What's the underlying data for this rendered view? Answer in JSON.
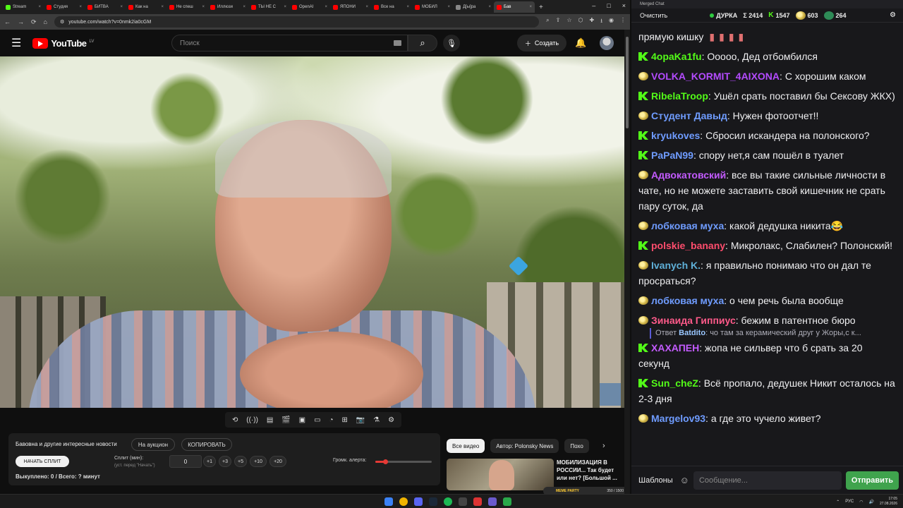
{
  "browser": {
    "tabs": [
      {
        "label": "Stream",
        "color": "#53fc18",
        "active": false
      },
      {
        "label": "Студия",
        "color": "#ff0000",
        "active": false
      },
      {
        "label": "БИТВА",
        "color": "#ff0000",
        "active": false
      },
      {
        "label": "Как на",
        "color": "#ff0000",
        "active": false
      },
      {
        "label": "Не спеш",
        "color": "#ff0000",
        "active": false
      },
      {
        "label": "Иллюзи",
        "color": "#ff0000",
        "active": false
      },
      {
        "label": "ТЫ НЕ С",
        "color": "#ff0000",
        "active": false
      },
      {
        "label": "OpenAI",
        "color": "#ff0000",
        "active": false
      },
      {
        "label": "ЯПОНИ",
        "color": "#ff0000",
        "active": false
      },
      {
        "label": "Все на",
        "color": "#ff0000",
        "active": false
      },
      {
        "label": "МОБИЛ",
        "color": "#ff0000",
        "active": false
      },
      {
        "label": "Д[ы]ра",
        "color": "#888888",
        "active": false
      },
      {
        "label": "Бав",
        "color": "#ff0000",
        "active": true
      }
    ],
    "url": "youtube.com/watch?v=0nmk2ia0cGM"
  },
  "youtube": {
    "logo_text": "YouTube",
    "region": "LV",
    "search_placeholder": "Поиск",
    "create_label": "Создать",
    "related_chips": [
      "Все видео",
      "Автор: Polonsky News",
      "Похо"
    ],
    "related_video_title": "МОБИЛИЗАЦИЯ В РОССИИ... Так будет или нет? [Большой ...",
    "thumb_tag": "МЕМЕ PARTY"
  },
  "panel": {
    "title": "Бавовна и другие интересные новости",
    "auction_label": "На аукцион",
    "copy_label": "КОПИРОВАТЬ",
    "start_split_label": "НАЧАТЬ СПЛИТ",
    "split_label": "Сплит (мин):",
    "split_sub": "(уст. перед \"Начать\")",
    "split_value": "0",
    "increments": [
      "+1",
      "+3",
      "+5",
      "+10",
      "+20"
    ],
    "volume_label": "Громк. алерта:",
    "volume_level": 0.17,
    "bought": "Выкуплено: 0 / Всего: ? минут",
    "counter": "350 / 1500"
  },
  "chat": {
    "window_title": "Merged Chat",
    "clear_label": "Очистить",
    "channel": "ДУРКА",
    "total": "Σ 2414",
    "kick_count": "1547",
    "twitch_count": "603",
    "other_count": "264",
    "messages": [
      {
        "badge": "none",
        "user": "",
        "color": "#efeff1",
        "text": "прямую кишку"
      },
      {
        "badge": "k",
        "user": "4opaKa1fu",
        "color": "#53fc18",
        "text": "Ооооо, Дед отбомбился"
      },
      {
        "badge": "t",
        "user": "VOLKA_KORMIT_4AIXONA",
        "color": "#b44bff",
        "text": "С хорошим каком"
      },
      {
        "badge": "k",
        "user": "RibelaTroop",
        "color": "#53fc18",
        "text": "Ушёл срать поставил бы Сексову ЖКХ)"
      },
      {
        "badge": "t",
        "user": "Студент Давыд",
        "color": "#6f9cff",
        "text": "Нужен фотоотчет!!"
      },
      {
        "badge": "k",
        "user": "kryukoves",
        "color": "#6f9cff",
        "text": "Сбросил искандера на полонского?"
      },
      {
        "badge": "k",
        "user": "PaPaN99",
        "color": "#6f9cff",
        "text": "спору нет,я сам пошёл в туалет"
      },
      {
        "badge": "t",
        "user": "Адвокатовский",
        "color": "#c35bff",
        "text": "все вы такие сильные личности в чате, но не можете заставить свой кишечник не срать пару суток, да"
      },
      {
        "badge": "t",
        "user": "лобковая муха",
        "color": "#6f9cff",
        "text": "какой дедушка никита😂"
      },
      {
        "badge": "k",
        "user": "polskie_banany",
        "color": "#ff4d6d",
        "text": "Микролакс, Слабилен? Полонский!"
      },
      {
        "badge": "t",
        "user": "Ivanych K.",
        "color": "#5fb0d8",
        "text": "я правильно понимаю что он дал те просраться?"
      },
      {
        "badge": "t",
        "user": "лобковая муха",
        "color": "#6f9cff",
        "text": "о чем речь была вообще"
      },
      {
        "badge": "t",
        "user": "Зинаида Гиппиус",
        "color": "#ff5a8a",
        "text": "бежим в патентное бюро",
        "reply_user": "Batdito",
        "reply_text": "чо там за керамический друг у Жоры,с к...",
        "reply_prefix": "Ответ"
      },
      {
        "badge": "k",
        "user": "ХАХАПЕН",
        "color": "#c35bff",
        "text": "жопа не сильвер что б срать за 20 секунд"
      },
      {
        "badge": "k",
        "user": "Sun_cheZ",
        "color": "#53fc18",
        "text": "Всё пропало, дедушек Никит осталось на 2-3 дня"
      },
      {
        "badge": "t",
        "user": "Margelov93",
        "color": "#6f9cff",
        "text": "а где это чучело живет?"
      }
    ],
    "templates_label": "Шаблоны",
    "input_placeholder": "Сообщение...",
    "send_label": "Отправить"
  },
  "taskbar": {
    "lang": "РУС",
    "time": "17:05",
    "date": "27.08.2026"
  }
}
